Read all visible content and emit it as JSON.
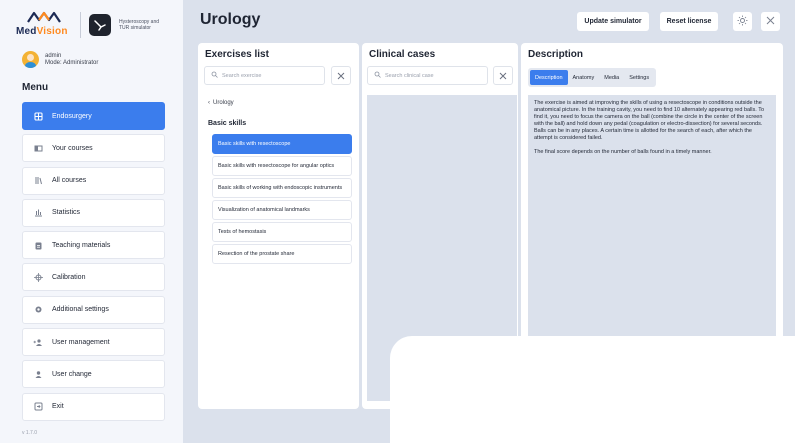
{
  "brand": {
    "logo_text_main": "Med",
    "logo_text_accent": "Vision",
    "simulator_text": "Hysteroscopy and TUR simulator"
  },
  "user": {
    "name": "admin",
    "mode": "Mode: Administrator"
  },
  "menu": {
    "title": "Menu",
    "items": [
      {
        "label": "Endosurgery",
        "icon": "grid-icon"
      },
      {
        "label": "Your courses",
        "icon": "book-icon"
      },
      {
        "label": "All courses",
        "icon": "library-icon"
      },
      {
        "label": "Statistics",
        "icon": "bar-chart-icon"
      },
      {
        "label": "Teaching materials",
        "icon": "clipboard-icon"
      },
      {
        "label": "Calibration",
        "icon": "crosshair-icon"
      },
      {
        "label": "Additional settings",
        "icon": "gear-icon"
      },
      {
        "label": "User management",
        "icon": "users-icon"
      },
      {
        "label": "User change",
        "icon": "user-icon"
      },
      {
        "label": "Exit",
        "icon": "exit-icon"
      }
    ],
    "version": "v 1.7.0"
  },
  "header": {
    "title": "Urology",
    "update_label": "Update simulator",
    "reset_label": "Reset license"
  },
  "exercises": {
    "title": "Exercises list",
    "search_placeholder": "Search exercise",
    "back_label": "Urology",
    "group_title": "Basic skills",
    "items": [
      "Basic skills with resectoscope",
      "Basic skills with resectoscope for angular optics",
      "Basic skills of working with endoscopic instruments",
      "Visualization of anatomical landmarks",
      "Tests of hemostasis",
      "Resection of the prostate share"
    ]
  },
  "cases": {
    "title": "Clinical cases",
    "search_placeholder": "Search clinical case"
  },
  "description": {
    "title": "Description",
    "tabs": [
      "Description",
      "Anatomy",
      "Media",
      "Settings"
    ],
    "paragraph1": "The exercise is aimed at improving the skills of using a resectoscope in conditions outside the anatomical picture. In the training cavity, you need to find 10 alternately appearing red balls. To find it, you need to focus the camera on the ball (combine the circle in the center of the screen with the ball) and hold down any pedal (coagulation or electro-dissection) for several seconds. Balls can be in any places. A certain time is allotted for the search of each, after which the attempt is considered failed.",
    "paragraph2": "The final score depends on the number of balls found in a timely manner."
  },
  "colors": {
    "accent": "#3b7ded",
    "brand_dark": "#1d2b55",
    "brand_orange": "#ff8a1f",
    "main_bg": "#dbe1ec"
  }
}
